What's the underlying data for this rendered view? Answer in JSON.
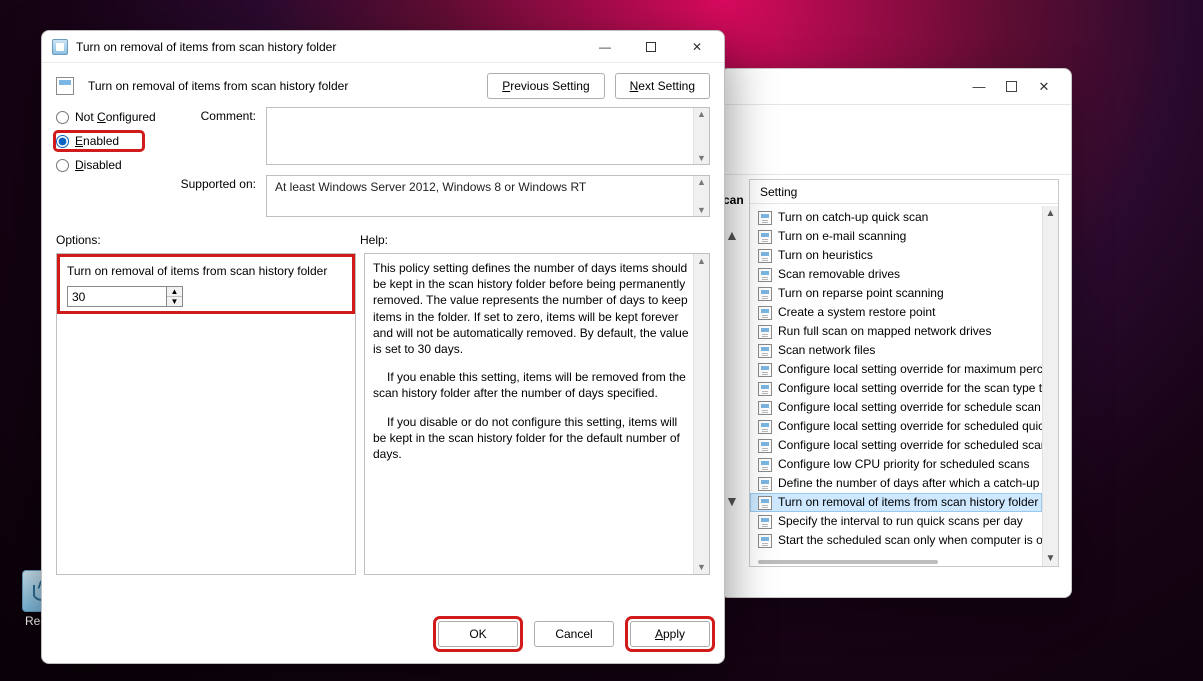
{
  "desktop": {
    "recycle_label": "Recycl"
  },
  "back_window": {
    "min_tip": "Minimize",
    "max_tip": "Maximize",
    "close_tip": "Close",
    "can_label": "can",
    "column_header": "Setting",
    "items": [
      "Turn on catch-up quick scan",
      "Turn on e-mail scanning",
      "Turn on heuristics",
      "Scan removable drives",
      "Turn on reparse point scanning",
      "Create a system restore point",
      "Run full scan on mapped network drives",
      "Scan network files",
      "Configure local setting override for maximum perce",
      "Configure local setting override for the scan type to",
      "Configure local setting override for schedule scan da",
      "Configure local setting override for scheduled quick",
      "Configure local setting override for scheduled scan t",
      "Configure low CPU priority for scheduled scans",
      "Define the number of days after which a catch-up sc",
      "Turn on removal of items from scan history folder",
      "Specify the interval to run quick scans per day",
      "Start the scheduled scan only when computer is on t"
    ],
    "selected_index": 15
  },
  "dialog": {
    "window_title": "Turn on removal of items from scan history folder",
    "caption": "Turn on removal of items from scan history folder",
    "nav": {
      "prev": "Previous Setting",
      "next": "Next Setting"
    },
    "state": {
      "not_configured": "Not Configured",
      "enabled": "Enabled",
      "disabled": "Disabled",
      "selected": "enabled"
    },
    "labels": {
      "comment": "Comment:",
      "supported_on": "Supported on:",
      "options": "Options:",
      "help": "Help:"
    },
    "comment_text": "",
    "supported_text": "At least Windows Server 2012, Windows 8 or Windows RT",
    "options": {
      "field_label": "Turn on removal of items from scan history folder",
      "value": "30"
    },
    "help_paragraphs": [
      "This policy setting defines the number of days items should be kept in the scan history folder before being permanently removed. The value represents the number of days to keep items in the folder. If set to zero, items will be kept forever and will not be automatically removed. By default, the value is set to 30 days.",
      "If you enable this setting, items will be removed from the scan history folder after the number of days specified.",
      "If you disable or do not configure this setting, items will be kept in the scan history folder for the default number of days."
    ],
    "buttons": {
      "ok": "OK",
      "cancel": "Cancel",
      "apply": "Apply"
    }
  }
}
